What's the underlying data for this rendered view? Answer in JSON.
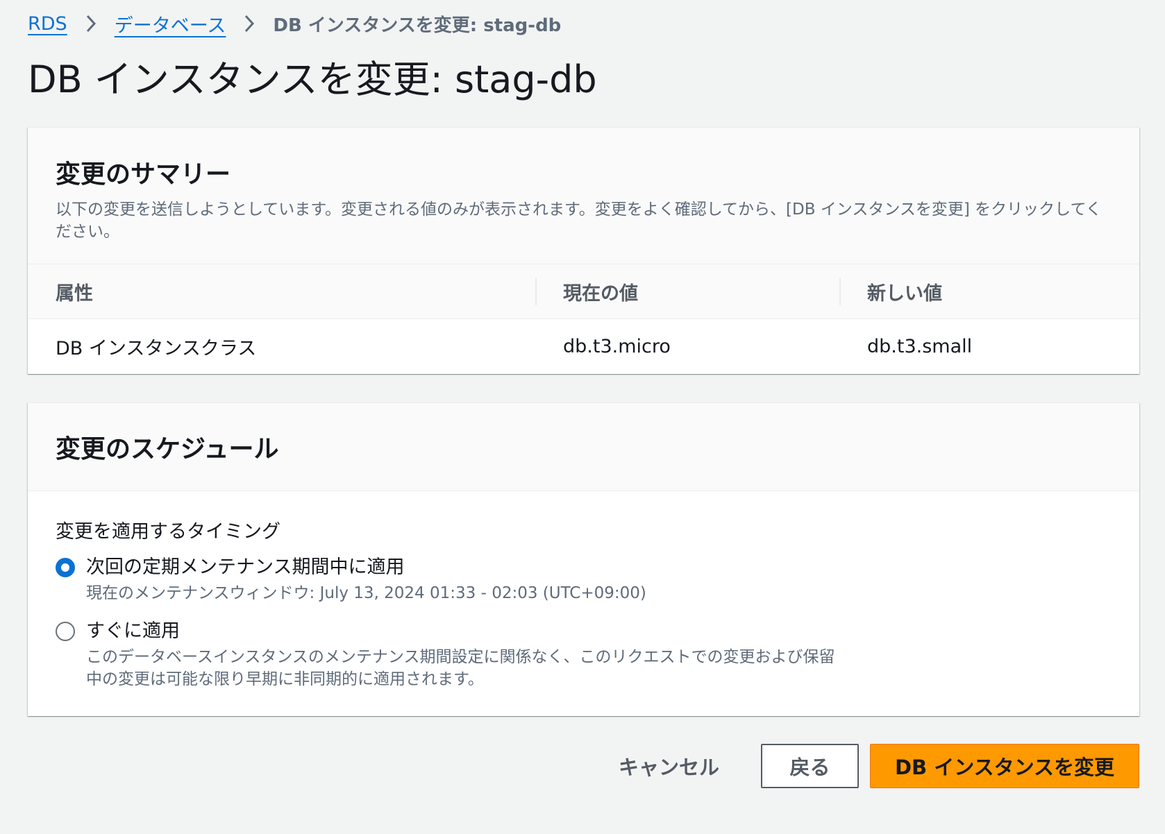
{
  "breadcrumb": {
    "items": [
      "RDS",
      "データベース"
    ],
    "current": "DB インスタンスを変更: stag-db"
  },
  "page_title": "DB インスタンスを変更: stag-db",
  "summary": {
    "title": "変更のサマリー",
    "description": "以下の変更を送信しようとしています。変更される値のみが表示されます。変更をよく確認してから、[DB インスタンスを変更] をクリックしてください。",
    "columns": [
      "属性",
      "現在の値",
      "新しい値"
    ],
    "rows": [
      {
        "attribute": "DB インスタンスクラス",
        "current": "db.t3.micro",
        "new": "db.t3.small"
      }
    ]
  },
  "schedule": {
    "title": "変更のスケジュール",
    "field_label": "変更を適用するタイミング",
    "options": [
      {
        "label": "次回の定期メンテナンス期間中に適用",
        "description": "現在のメンテナンスウィンドウ: July 13, 2024 01:33 - 02:03 (UTC+09:00)",
        "selected": true
      },
      {
        "label": "すぐに適用",
        "description": "このデータベースインスタンスのメンテナンス期間設定に関係なく、このリクエストでの変更および保留中の変更は可能な限り早期に非同期的に適用されます。",
        "selected": false
      }
    ]
  },
  "footer": {
    "cancel_label": "キャンセル",
    "back_label": "戻る",
    "submit_label": "DB インスタンスを変更"
  },
  "colors": {
    "link": "#0972d3",
    "primary_button": "#ff9900",
    "background": "#f2f3f3"
  }
}
